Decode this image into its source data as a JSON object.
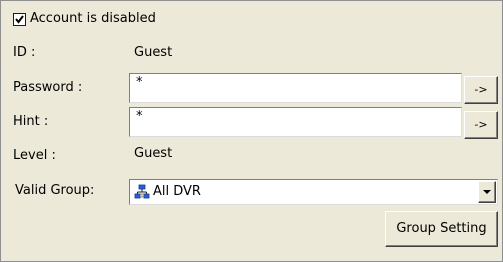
{
  "account": {
    "disabled_checked": true,
    "disabled_label": "Account is disabled"
  },
  "fields": {
    "id": {
      "label": "ID :",
      "value": "Guest"
    },
    "password": {
      "label": "Password :",
      "value": "*",
      "button": "->"
    },
    "hint": {
      "label": "Hint :",
      "value": "*",
      "button": "->"
    },
    "level": {
      "label": "Level :",
      "value": "Guest"
    },
    "valid_group": {
      "label": "Valid Group:",
      "selected": "All DVR",
      "icon": "network-group-icon"
    }
  },
  "buttons": {
    "group_setting": "Group Setting"
  }
}
